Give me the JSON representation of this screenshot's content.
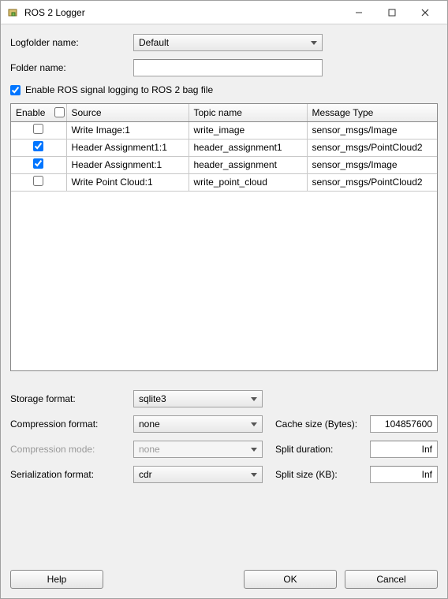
{
  "window": {
    "title": "ROS 2 Logger"
  },
  "labels": {
    "logfolder_name": "Logfolder name:",
    "folder_name": "Folder name:",
    "enable_checkbox": "Enable ROS signal logging to ROS 2 bag file",
    "storage_format": "Storage format:",
    "compression_format": "Compression format:",
    "compression_mode": "Compression mode:",
    "serialization_format": "Serialization format:",
    "cache_size": "Cache size (Bytes):",
    "split_duration": "Split duration:",
    "split_size": "Split size (KB):"
  },
  "values": {
    "logfolder_selected": "Default",
    "folder_name_value": "",
    "enable_logging": true,
    "storage_format": "sqlite3",
    "compression_format": "none",
    "compression_mode": "none",
    "serialization_format": "cdr",
    "cache_size": "104857600",
    "split_duration": "Inf",
    "split_size": "Inf"
  },
  "table": {
    "headers": {
      "enable": "Enable",
      "source": "Source",
      "topic": "Topic name",
      "msgtype": "Message Type"
    },
    "rows": [
      {
        "enabled": false,
        "source": "Write Image:1",
        "topic": "write_image",
        "msgtype": "sensor_msgs/Image"
      },
      {
        "enabled": true,
        "source": "Header Assignment1:1",
        "topic": "header_assignment1",
        "msgtype": "sensor_msgs/PointCloud2"
      },
      {
        "enabled": true,
        "source": "Header Assignment:1",
        "topic": "header_assignment",
        "msgtype": "sensor_msgs/Image"
      },
      {
        "enabled": false,
        "source": "Write Point Cloud:1",
        "topic": "write_point_cloud",
        "msgtype": "sensor_msgs/PointCloud2"
      }
    ]
  },
  "buttons": {
    "help": "Help",
    "ok": "OK",
    "cancel": "Cancel"
  }
}
